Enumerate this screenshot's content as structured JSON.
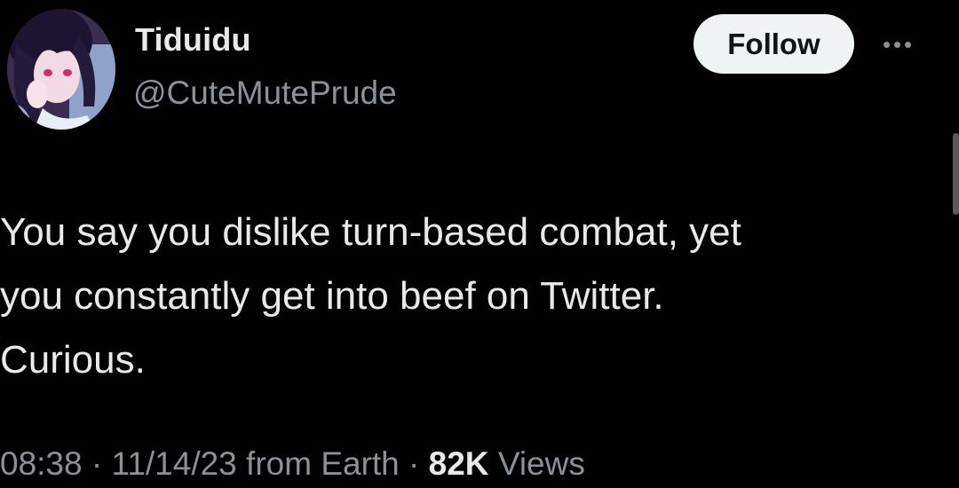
{
  "author": {
    "display_name": "Tiduidu",
    "handle": "@CuteMutePrude",
    "avatar_icon": "avatar-anime-girl"
  },
  "actions": {
    "follow_label": "Follow",
    "more_icon": "more-horizontal-icon"
  },
  "tweet": {
    "text_lines": [
      "You say you dislike turn-based combat, yet",
      "you constantly get into beef on Twitter.",
      "Curious."
    ]
  },
  "meta": {
    "time": "08:38",
    "separator": " · ",
    "date": "11/14/23",
    "source": "from Earth",
    "views_count": "82K",
    "views_label": "Views"
  },
  "colors": {
    "background": "#000000",
    "text_primary": "#e7e9ea",
    "text_secondary": "#8b9198",
    "follow_bg": "#eff3f4",
    "follow_text": "#0f1419"
  }
}
